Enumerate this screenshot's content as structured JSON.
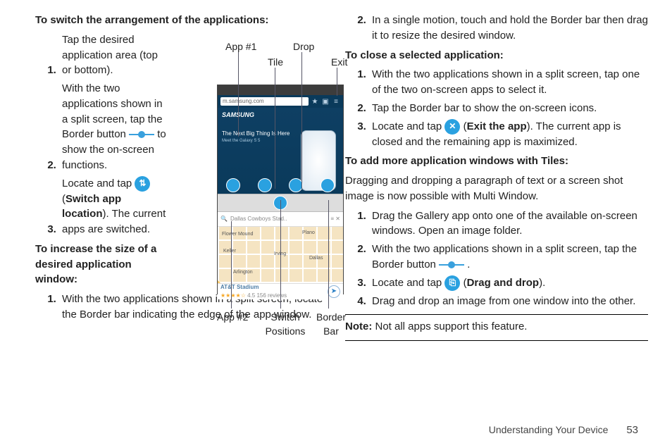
{
  "left": {
    "h1": "To switch the arrangement of the applications:",
    "s1_1": "Tap the desired application area (top or bottom).",
    "s1_2a": "With the two applications shown in a split screen, tap the Border button ",
    "s1_2b": " to show the on-screen functions.",
    "s1_3a": "Locate and tap ",
    "s1_3b": " (",
    "s1_3bold": "Switch app location",
    "s1_3c": "). The current apps are switched.",
    "h2": "To increase the size of a desired application window:",
    "s2_1": "With the two applications shown in a split screen, locate the Border bar indicating the edge of the app window."
  },
  "fig": {
    "app1": "App #1",
    "tile": "Tile",
    "drop": "Drop",
    "exit": "Exit",
    "app2": "App #2",
    "switch": "Switch Positions",
    "border": "Border Bar",
    "url": "m.samsung.com",
    "samsung": "SAMSUNG",
    "tag1": "The Next Big Thing Is Here",
    "tag2": "Meet the Galaxy S 5",
    "search": "Dallas Cowboys Stad..",
    "stadium": "AT&T Stadium",
    "reviews": "4.5 156 reviews",
    "c1": "Flower Mound",
    "c2": "Plano",
    "c3": "Irving",
    "c4": "Dallas",
    "c5": "Arlington",
    "c6": "Keller"
  },
  "right": {
    "s0_2": "In a single motion, touch and hold the Border bar then drag it to resize the desired window.",
    "h1": "To close a selected application:",
    "s1_1": "With the two applications shown in a split screen, tap one of the two on-screen apps to select it.",
    "s1_2": "Tap the Border bar to show the on-screen icons.",
    "s1_3a": "Locate and tap ",
    "s1_3bold": "Exit the app",
    "s1_3b": "). The current app is closed and the remaining app is maximized.",
    "h2": "To add more application windows with Tiles:",
    "intro": "Dragging and dropping a paragraph of text or a screen shot image is now possible with Multi Window.",
    "s2_1": "Drag the Gallery app onto one of the available on-screen windows. Open an image folder.",
    "s2_2a": "With the two applications shown in a split screen, tap the Border button ",
    "s2_2b": " .",
    "s2_3a": "Locate and tap ",
    "s2_3bold": "Drag and drop",
    "s2_3b": ").",
    "s2_4": "Drag and drop an image from one window into the other.",
    "note": "Note:",
    "note_body": " Not all apps support this feature."
  },
  "footer": {
    "section": "Understanding Your Device",
    "page": "53"
  }
}
